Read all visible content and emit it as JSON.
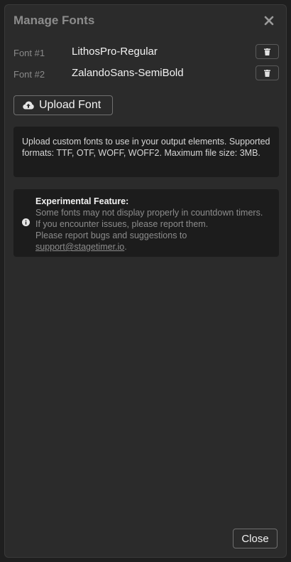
{
  "dialog": {
    "title": "Manage Fonts",
    "close_icon": "close-icon"
  },
  "fonts": [
    {
      "label": "Font #1",
      "name": "LithosPro-Regular",
      "delete_icon": "trash-icon"
    },
    {
      "label": "Font #2",
      "name": "ZalandoSans-SemiBold",
      "delete_icon": "trash-icon"
    }
  ],
  "upload": {
    "label": "Upload Font",
    "icon": "cloud-upload-icon"
  },
  "info": {
    "text": "Upload custom fonts to use in your output elements. Supported formats: TTF, OTF, WOFF, WOFF2. Maximum file size: 3MB."
  },
  "experimental": {
    "icon": "info-icon",
    "title": "Experimental Feature:",
    "line1": "Some fonts may not display properly in countdown timers.",
    "line2": "If you encounter issues, please report them.",
    "line3": "Please report bugs and suggestions to",
    "link": "support@stagetimer.io",
    "link_suffix": "."
  },
  "footer": {
    "close_label": "Close"
  },
  "colors": {
    "background": "#2b2b2b",
    "panel": "#1c1c1c",
    "text_primary": "#f2f2f2",
    "text_muted": "#8c8c8c"
  }
}
